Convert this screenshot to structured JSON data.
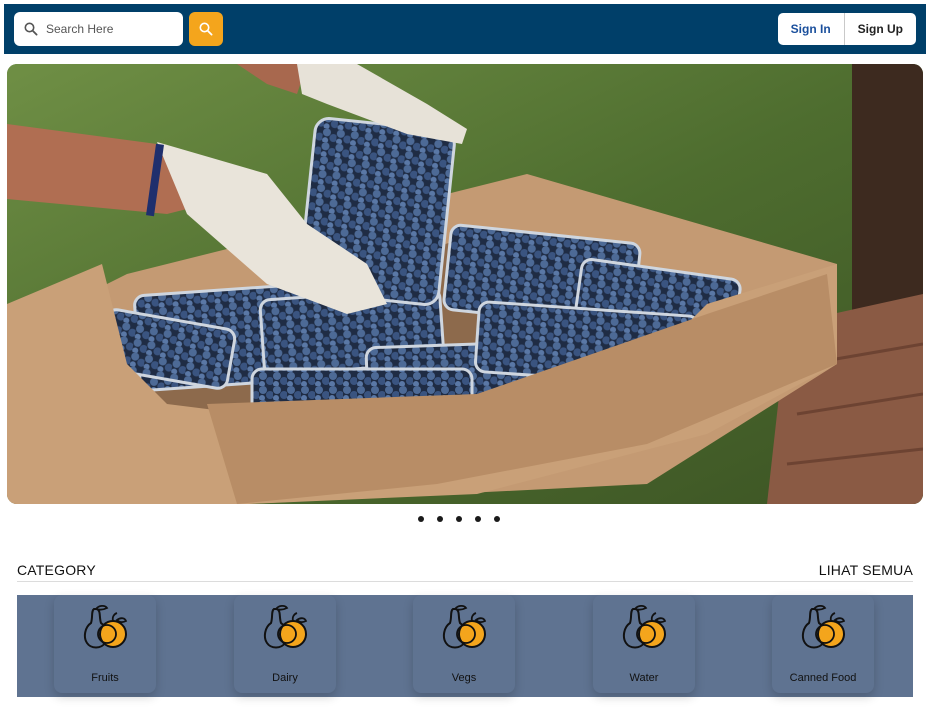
{
  "header": {
    "search": {
      "placeholder": "Search Here",
      "value": ""
    },
    "search_button_icon": "search-icon",
    "sign_in_label": "Sign In",
    "sign_up_label": "Sign Up",
    "colors": {
      "bar": "#003f69",
      "accent": "#f4a51c",
      "sign_in_text": "#1a4f9c"
    }
  },
  "hero": {
    "image_alt": "Gloved hands holding a tray of blueberries over a cardboard box of blueberry punnets",
    "slide_count": 5,
    "active_slide": 1
  },
  "category": {
    "title": "CATEGORY",
    "see_all_label": "LIHAT SEMUA",
    "items": [
      {
        "label": "Fruits",
        "icon": "fruits-icon"
      },
      {
        "label": "Dairy",
        "icon": "fruits-icon"
      },
      {
        "label": "Vegs",
        "icon": "fruits-icon"
      },
      {
        "label": "Water",
        "icon": "fruits-icon"
      },
      {
        "label": "Canned Food",
        "icon": "fruits-icon"
      }
    ],
    "colors": {
      "strip": "#5f7391",
      "icon_fill": "#f4a51c"
    }
  }
}
